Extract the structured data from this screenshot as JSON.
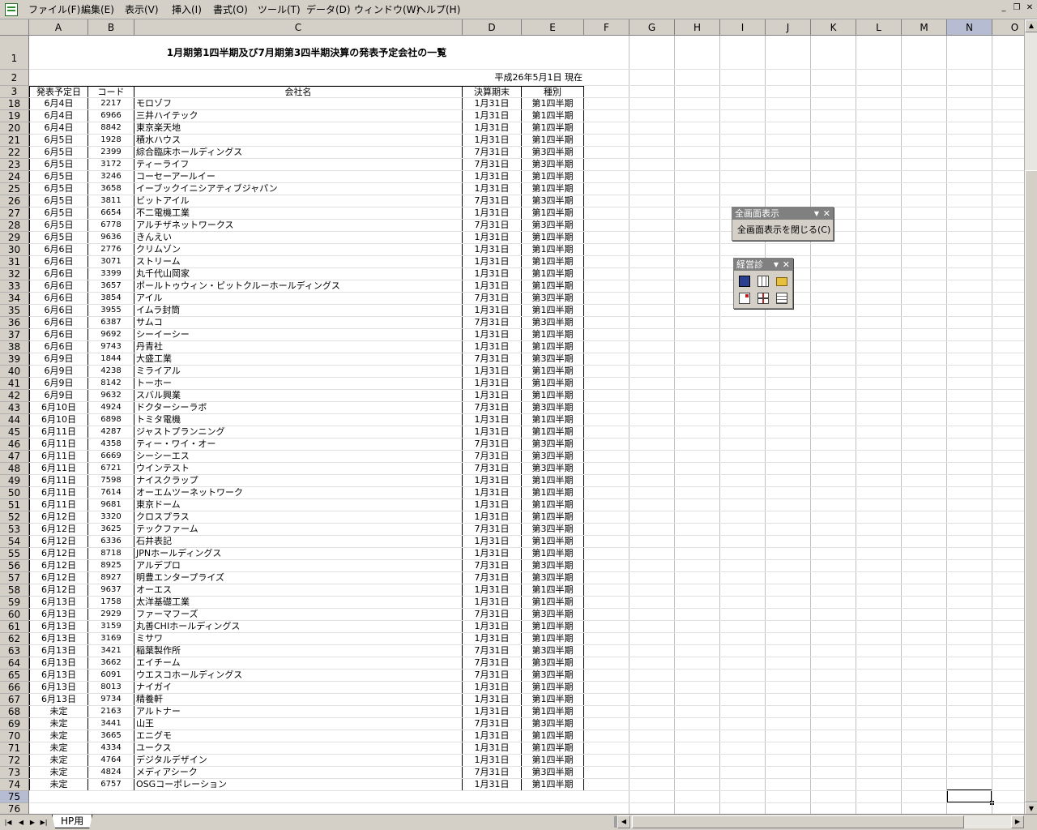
{
  "menubar": {
    "items": [
      "ファイル(F)",
      "編集(E)",
      "表示(V)",
      "挿入(I)",
      "書式(O)",
      "ツール(T)",
      "データ(D)",
      "ウィンドウ(W)",
      "ヘルプ(H)"
    ]
  },
  "columns": [
    "A",
    "B",
    "C",
    "D",
    "E",
    "F",
    "G",
    "H",
    "I",
    "J",
    "K",
    "L",
    "M",
    "N",
    "O"
  ],
  "selected_column": "N",
  "selected_row": "75",
  "sheet": {
    "title": "1月期第1四半期及び7月期第3四半期決算の発表予定会社の一覧",
    "as_of": "平成26年5月1日 現在",
    "headers": [
      "発表予定日",
      "コード",
      "会社名",
      "決算期末",
      "種別"
    ],
    "rows": [
      {
        "row": "18",
        "date": "6月4日",
        "code": "2217",
        "name": "モロゾフ",
        "fy": "1月31日",
        "type": "第1四半期"
      },
      {
        "row": "19",
        "date": "6月4日",
        "code": "6966",
        "name": "三井ハイテック",
        "fy": "1月31日",
        "type": "第1四半期"
      },
      {
        "row": "20",
        "date": "6月4日",
        "code": "8842",
        "name": "東京楽天地",
        "fy": "1月31日",
        "type": "第1四半期"
      },
      {
        "row": "21",
        "date": "6月5日",
        "code": "1928",
        "name": "積水ハウス",
        "fy": "1月31日",
        "type": "第1四半期"
      },
      {
        "row": "22",
        "date": "6月5日",
        "code": "2399",
        "name": "綜合臨床ホールディングス",
        "fy": "7月31日",
        "type": "第3四半期"
      },
      {
        "row": "23",
        "date": "6月5日",
        "code": "3172",
        "name": "ティーライフ",
        "fy": "7月31日",
        "type": "第3四半期"
      },
      {
        "row": "24",
        "date": "6月5日",
        "code": "3246",
        "name": "コーセーアールイー",
        "fy": "1月31日",
        "type": "第1四半期"
      },
      {
        "row": "25",
        "date": "6月5日",
        "code": "3658",
        "name": "イーブックイニシアティブジャパン",
        "fy": "1月31日",
        "type": "第1四半期"
      },
      {
        "row": "26",
        "date": "6月5日",
        "code": "3811",
        "name": "ビットアイル",
        "fy": "7月31日",
        "type": "第3四半期"
      },
      {
        "row": "27",
        "date": "6月5日",
        "code": "6654",
        "name": "不二電機工業",
        "fy": "1月31日",
        "type": "第1四半期"
      },
      {
        "row": "28",
        "date": "6月5日",
        "code": "6778",
        "name": "アルチザネットワークス",
        "fy": "7月31日",
        "type": "第3四半期"
      },
      {
        "row": "29",
        "date": "6月5日",
        "code": "9636",
        "name": "きんえい",
        "fy": "1月31日",
        "type": "第1四半期"
      },
      {
        "row": "30",
        "date": "6月6日",
        "code": "2776",
        "name": "クリムゾン",
        "fy": "1月31日",
        "type": "第1四半期"
      },
      {
        "row": "31",
        "date": "6月6日",
        "code": "3071",
        "name": "ストリーム",
        "fy": "1月31日",
        "type": "第1四半期"
      },
      {
        "row": "32",
        "date": "6月6日",
        "code": "3399",
        "name": "丸千代山岡家",
        "fy": "1月31日",
        "type": "第1四半期"
      },
      {
        "row": "33",
        "date": "6月6日",
        "code": "3657",
        "name": "ポールトゥウィン・ピットクルーホールディングス",
        "fy": "1月31日",
        "type": "第1四半期"
      },
      {
        "row": "34",
        "date": "6月6日",
        "code": "3854",
        "name": "アイル",
        "fy": "7月31日",
        "type": "第3四半期"
      },
      {
        "row": "35",
        "date": "6月6日",
        "code": "3955",
        "name": "イムラ封筒",
        "fy": "1月31日",
        "type": "第1四半期"
      },
      {
        "row": "36",
        "date": "6月6日",
        "code": "6387",
        "name": "サムコ",
        "fy": "7月31日",
        "type": "第3四半期"
      },
      {
        "row": "37",
        "date": "6月6日",
        "code": "9692",
        "name": "シーイーシー",
        "fy": "1月31日",
        "type": "第1四半期"
      },
      {
        "row": "38",
        "date": "6月6日",
        "code": "9743",
        "name": "丹青社",
        "fy": "1月31日",
        "type": "第1四半期"
      },
      {
        "row": "39",
        "date": "6月9日",
        "code": "1844",
        "name": "大盛工業",
        "fy": "7月31日",
        "type": "第3四半期"
      },
      {
        "row": "40",
        "date": "6月9日",
        "code": "4238",
        "name": "ミライアル",
        "fy": "1月31日",
        "type": "第1四半期"
      },
      {
        "row": "41",
        "date": "6月9日",
        "code": "8142",
        "name": "トーホー",
        "fy": "1月31日",
        "type": "第1四半期"
      },
      {
        "row": "42",
        "date": "6月9日",
        "code": "9632",
        "name": "スバル興業",
        "fy": "1月31日",
        "type": "第1四半期"
      },
      {
        "row": "43",
        "date": "6月10日",
        "code": "4924",
        "name": "ドクターシーラボ",
        "fy": "7月31日",
        "type": "第3四半期"
      },
      {
        "row": "44",
        "date": "6月10日",
        "code": "6898",
        "name": "トミタ電機",
        "fy": "1月31日",
        "type": "第1四半期"
      },
      {
        "row": "45",
        "date": "6月11日",
        "code": "4287",
        "name": "ジャストプランニング",
        "fy": "1月31日",
        "type": "第1四半期"
      },
      {
        "row": "46",
        "date": "6月11日",
        "code": "4358",
        "name": "ティー・ワイ・オー",
        "fy": "7月31日",
        "type": "第3四半期"
      },
      {
        "row": "47",
        "date": "6月11日",
        "code": "6669",
        "name": "シーシーエス",
        "fy": "7月31日",
        "type": "第3四半期"
      },
      {
        "row": "48",
        "date": "6月11日",
        "code": "6721",
        "name": "ウインテスト",
        "fy": "7月31日",
        "type": "第3四半期"
      },
      {
        "row": "49",
        "date": "6月11日",
        "code": "7598",
        "name": "ナイスクラップ",
        "fy": "1月31日",
        "type": "第1四半期"
      },
      {
        "row": "50",
        "date": "6月11日",
        "code": "7614",
        "name": "オーエムツーネットワーク",
        "fy": "1月31日",
        "type": "第1四半期"
      },
      {
        "row": "51",
        "date": "6月11日",
        "code": "9681",
        "name": "東京ドーム",
        "fy": "1月31日",
        "type": "第1四半期"
      },
      {
        "row": "52",
        "date": "6月12日",
        "code": "3320",
        "name": "クロスプラス",
        "fy": "1月31日",
        "type": "第1四半期"
      },
      {
        "row": "53",
        "date": "6月12日",
        "code": "3625",
        "name": "テックファーム",
        "fy": "7月31日",
        "type": "第3四半期"
      },
      {
        "row": "54",
        "date": "6月12日",
        "code": "6336",
        "name": "石井表記",
        "fy": "1月31日",
        "type": "第1四半期"
      },
      {
        "row": "55",
        "date": "6月12日",
        "code": "8718",
        "name": "JPNホールディングス",
        "fy": "1月31日",
        "type": "第1四半期"
      },
      {
        "row": "56",
        "date": "6月12日",
        "code": "8925",
        "name": "アルデプロ",
        "fy": "7月31日",
        "type": "第3四半期"
      },
      {
        "row": "57",
        "date": "6月12日",
        "code": "8927",
        "name": "明豊エンタープライズ",
        "fy": "7月31日",
        "type": "第3四半期"
      },
      {
        "row": "58",
        "date": "6月12日",
        "code": "9637",
        "name": "オーエス",
        "fy": "1月31日",
        "type": "第1四半期"
      },
      {
        "row": "59",
        "date": "6月13日",
        "code": "1758",
        "name": "太洋基礎工業",
        "fy": "1月31日",
        "type": "第1四半期"
      },
      {
        "row": "60",
        "date": "6月13日",
        "code": "2929",
        "name": "ファーマフーズ",
        "fy": "7月31日",
        "type": "第3四半期"
      },
      {
        "row": "61",
        "date": "6月13日",
        "code": "3159",
        "name": "丸善CHIホールディングス",
        "fy": "1月31日",
        "type": "第1四半期"
      },
      {
        "row": "62",
        "date": "6月13日",
        "code": "3169",
        "name": "ミサワ",
        "fy": "1月31日",
        "type": "第1四半期"
      },
      {
        "row": "63",
        "date": "6月13日",
        "code": "3421",
        "name": "稲葉製作所",
        "fy": "7月31日",
        "type": "第3四半期"
      },
      {
        "row": "64",
        "date": "6月13日",
        "code": "3662",
        "name": "エイチーム",
        "fy": "7月31日",
        "type": "第3四半期"
      },
      {
        "row": "65",
        "date": "6月13日",
        "code": "6091",
        "name": "ウエスコホールディングス",
        "fy": "7月31日",
        "type": "第3四半期"
      },
      {
        "row": "66",
        "date": "6月13日",
        "code": "8013",
        "name": "ナイガイ",
        "fy": "1月31日",
        "type": "第1四半期"
      },
      {
        "row": "67",
        "date": "6月13日",
        "code": "9734",
        "name": "精養軒",
        "fy": "1月31日",
        "type": "第1四半期"
      },
      {
        "row": "68",
        "date": "未定",
        "code": "2163",
        "name": "アルトナー",
        "fy": "1月31日",
        "type": "第1四半期"
      },
      {
        "row": "69",
        "date": "未定",
        "code": "3441",
        "name": "山王",
        "fy": "7月31日",
        "type": "第3四半期"
      },
      {
        "row": "70",
        "date": "未定",
        "code": "3665",
        "name": "エニグモ",
        "fy": "1月31日",
        "type": "第1四半期"
      },
      {
        "row": "71",
        "date": "未定",
        "code": "4334",
        "name": "ユークス",
        "fy": "1月31日",
        "type": "第1四半期"
      },
      {
        "row": "72",
        "date": "未定",
        "code": "4764",
        "name": "デジタルデザイン",
        "fy": "1月31日",
        "type": "第1四半期"
      },
      {
        "row": "73",
        "date": "未定",
        "code": "4824",
        "name": "メディアシーク",
        "fy": "7月31日",
        "type": "第3四半期"
      },
      {
        "row": "74",
        "date": "未定",
        "code": "6757",
        "name": "OSGコーポレーション",
        "fy": "1月31日",
        "type": "第1四半期"
      }
    ],
    "trailing_rows": [
      "75",
      "76"
    ]
  },
  "sheet_tab": "HP用",
  "fullscreen_toolbar": {
    "title": "全画面表示",
    "close_label": "全画面表示を閉じる(C)"
  },
  "keishin_toolbar": {
    "title": "経営診"
  },
  "colors": {
    "chrome": "#d4d0c8",
    "header_selected": "#b6bdd2",
    "toolbar_title": "#808080"
  }
}
